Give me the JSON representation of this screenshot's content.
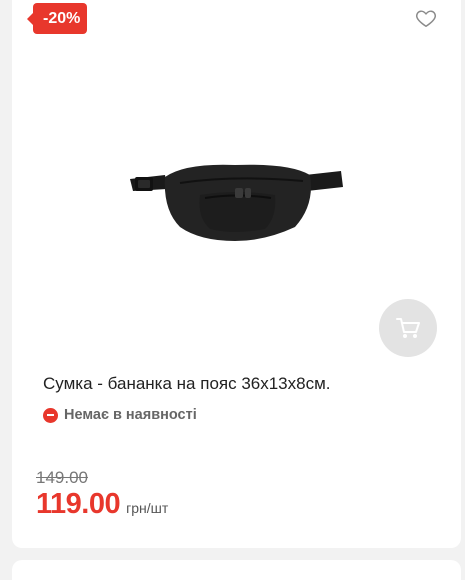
{
  "product": {
    "discount_badge": "-20%",
    "title": "Сумка - бананка на пояс 36х13х8см.",
    "availability": "Немає в наявності",
    "old_price": "149.00",
    "price": "119.00",
    "unit": "грн/шт"
  },
  "icons": {
    "favorite": "heart-outline-icon",
    "cart": "cart-icon",
    "availability": "minus-circle-icon"
  },
  "colors": {
    "accent": "#e8372c",
    "cart_button_bg": "#e3e3e3",
    "page_bg": "#f2f2f2"
  }
}
